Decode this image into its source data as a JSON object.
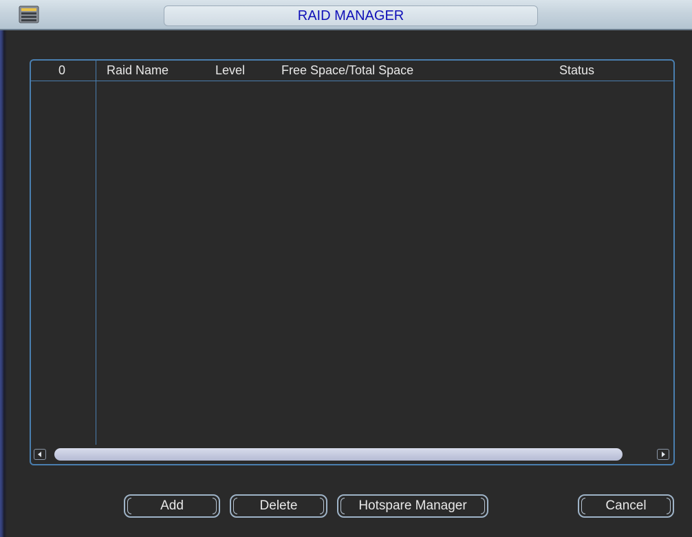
{
  "window": {
    "title": "RAID MANAGER"
  },
  "table": {
    "columns": [
      "0",
      "Raid Name",
      "Level",
      "Free Space/Total Space",
      "Status"
    ],
    "rows": []
  },
  "buttons": {
    "add": "Add",
    "delete": "Delete",
    "hotspare": "Hotspare Manager",
    "cancel": "Cancel"
  },
  "icons": {
    "window_icon": "raid-icon",
    "scroll_left": "arrow-left-icon",
    "scroll_right": "arrow-right-icon"
  },
  "colors": {
    "title_text": "#1010b8",
    "border_accent": "#4a7fb0",
    "background": "#2a2a2a"
  }
}
